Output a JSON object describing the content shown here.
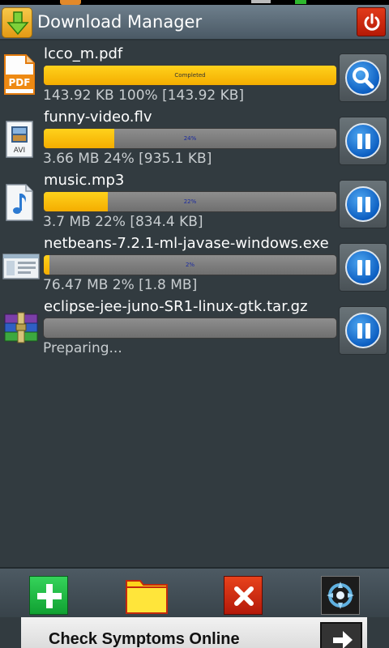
{
  "app": {
    "title": "Download Manager"
  },
  "downloads": [
    {
      "name": "lcco_m.pdf",
      "icon": "pdf-file-icon",
      "progress": 100,
      "progress_label": "Completed",
      "stats": "143.92 KB  100% [143.92 KB]",
      "action": "search-icon"
    },
    {
      "name": "funny-video.flv",
      "icon": "avi-video-file-icon",
      "progress": 24,
      "progress_label": "24%",
      "stats": "3.66 MB  24% [935.1 KB]",
      "action": "pause-icon"
    },
    {
      "name": "music.mp3",
      "icon": "music-file-icon",
      "progress": 22,
      "progress_label": "22%",
      "stats": "3.7 MB  22% [834.4 KB]",
      "action": "pause-icon"
    },
    {
      "name": "netbeans-7.2.1-ml-javase-windows.exe",
      "icon": "exe-file-icon",
      "progress": 2,
      "progress_label": "2%",
      "stats": "76.47 MB  2% [1.8 MB]",
      "action": "pause-icon"
    },
    {
      "name": "eclipse-jee-juno-SR1-linux-gtk.tar.gz",
      "icon": "archive-file-icon",
      "progress": 0,
      "progress_label": "",
      "stats": "Preparing...",
      "action": "pause-icon"
    }
  ],
  "toolbar": {
    "items": [
      "add-icon",
      "folder-icon",
      "clear-icon",
      "settings-icon"
    ]
  },
  "ad": {
    "text": "Check Symptoms Online"
  },
  "colors": {
    "progress_fill": "#f4ad00",
    "background": "#323b40",
    "action_blue": "#0d5fc2",
    "power_red": "#c8240a"
  }
}
